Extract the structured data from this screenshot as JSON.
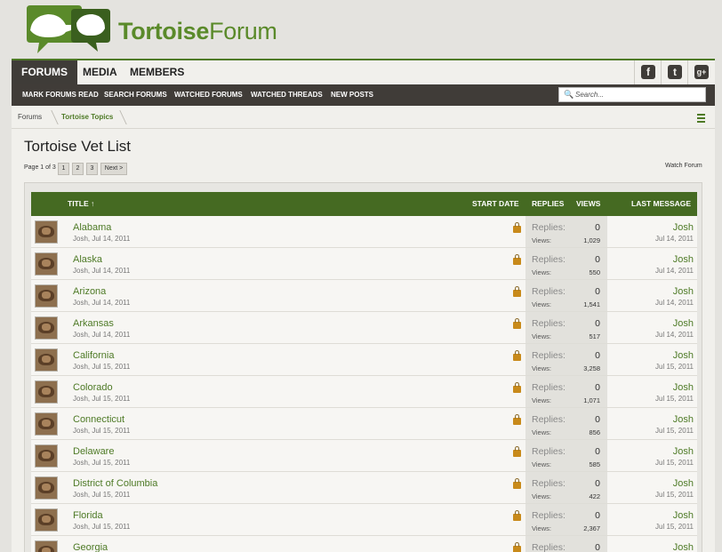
{
  "logo": {
    "text_bold": "Tortoise",
    "text_regular": "Forum"
  },
  "nav": {
    "tabs": [
      "FORUMS",
      "MEDIA",
      "MEMBERS"
    ]
  },
  "social": {
    "facebook": "f",
    "twitter": "t",
    "googleplus": "g+"
  },
  "subnav": {
    "links": [
      "MARK FORUMS READ",
      "SEARCH FORUMS",
      "WATCHED FORUMS",
      "WATCHED THREADS",
      "NEW POSTS"
    ],
    "search_placeholder": "Search..."
  },
  "breadcrumb": [
    "Forums",
    "Tortoise Topics"
  ],
  "page": {
    "title": "Tortoise Vet List",
    "page_text": "Page 1 of 3",
    "pages": [
      "1",
      "2",
      "3"
    ],
    "next": "Next >",
    "watch": "Watch Forum"
  },
  "table": {
    "headers": {
      "title": "TITLE ↑",
      "start_date": "START DATE",
      "replies": "REPLIES",
      "views": "VIEWS",
      "last_message": "LAST MESSAGE"
    },
    "replies_label": "Replies:",
    "views_label": "Views:",
    "rows": [
      {
        "title": "Alabama",
        "meta": "Josh, Jul 14, 2011",
        "replies": "0",
        "views": "1,029",
        "last_user": "Josh",
        "last_date": "Jul 14, 2011"
      },
      {
        "title": "Alaska",
        "meta": "Josh, Jul 14, 2011",
        "replies": "0",
        "views": "550",
        "last_user": "Josh",
        "last_date": "Jul 14, 2011"
      },
      {
        "title": "Arizona",
        "meta": "Josh, Jul 14, 2011",
        "replies": "0",
        "views": "1,541",
        "last_user": "Josh",
        "last_date": "Jul 14, 2011"
      },
      {
        "title": "Arkansas",
        "meta": "Josh, Jul 14, 2011",
        "replies": "0",
        "views": "517",
        "last_user": "Josh",
        "last_date": "Jul 14, 2011"
      },
      {
        "title": "California",
        "meta": "Josh, Jul 15, 2011",
        "replies": "0",
        "views": "3,258",
        "last_user": "Josh",
        "last_date": "Jul 15, 2011"
      },
      {
        "title": "Colorado",
        "meta": "Josh, Jul 15, 2011",
        "replies": "0",
        "views": "1,071",
        "last_user": "Josh",
        "last_date": "Jul 15, 2011"
      },
      {
        "title": "Connecticut",
        "meta": "Josh, Jul 15, 2011",
        "replies": "0",
        "views": "856",
        "last_user": "Josh",
        "last_date": "Jul 15, 2011"
      },
      {
        "title": "Delaware",
        "meta": "Josh, Jul 15, 2011",
        "replies": "0",
        "views": "585",
        "last_user": "Josh",
        "last_date": "Jul 15, 2011"
      },
      {
        "title": "District of Columbia",
        "meta": "Josh, Jul 15, 2011",
        "replies": "0",
        "views": "422",
        "last_user": "Josh",
        "last_date": "Jul 15, 2011"
      },
      {
        "title": "Florida",
        "meta": "Josh, Jul 15, 2011",
        "replies": "0",
        "views": "2,367",
        "last_user": "Josh",
        "last_date": "Jul 15, 2011"
      },
      {
        "title": "Georgia",
        "meta": "",
        "replies": "0",
        "views": "",
        "last_user": "Josh",
        "last_date": ""
      }
    ]
  },
  "colors": {
    "brand_green": "#4e7a26",
    "header_green": "#456a22",
    "dark_bar": "#403c38"
  }
}
